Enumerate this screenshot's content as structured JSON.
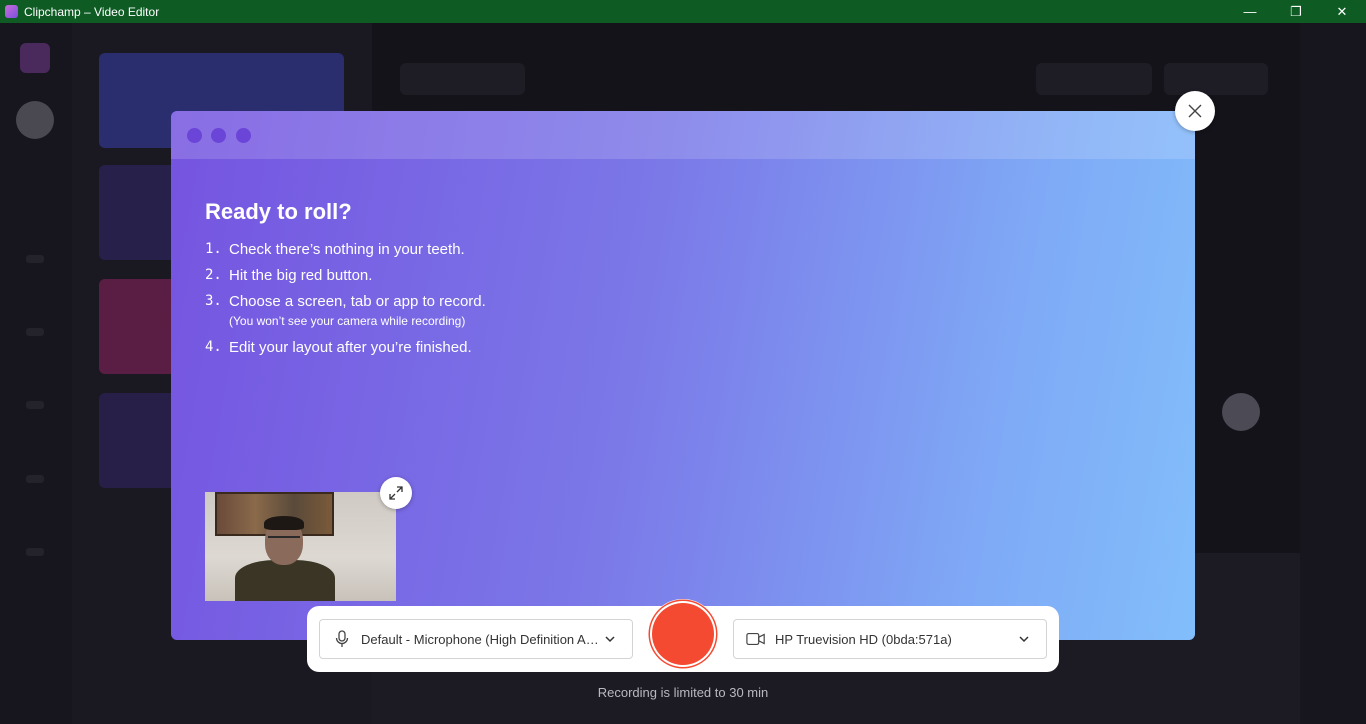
{
  "window": {
    "title": "Clipchamp – Video Editor",
    "minimize_glyph": "—",
    "maximize_glyph": "❐",
    "close_glyph": "✕"
  },
  "modal": {
    "heading": "Ready to roll?",
    "steps": [
      {
        "num": "1.",
        "text": "Check there’s nothing in your teeth."
      },
      {
        "num": "2.",
        "text": "Hit the big red button."
      },
      {
        "num": "3.",
        "text": "Choose a screen, tab or app to record.",
        "note": "(You won’t see your camera while recording)"
      },
      {
        "num": "4.",
        "text": "Edit your layout after you’re finished."
      }
    ]
  },
  "controls": {
    "microphone": {
      "value": "Default - Microphone (High Definition Audio Device)",
      "icon": "microphone-icon"
    },
    "camera": {
      "value": "HP Truevision HD (0bda:571a)",
      "icon": "video-camera-icon"
    },
    "record_color": "#f54a32"
  },
  "footer": {
    "limit_text": "Recording is limited to 30 min"
  },
  "colors": {
    "titlebar": "#0e5c24",
    "gradient_start": "#7554e0",
    "gradient_end": "#82befb"
  }
}
